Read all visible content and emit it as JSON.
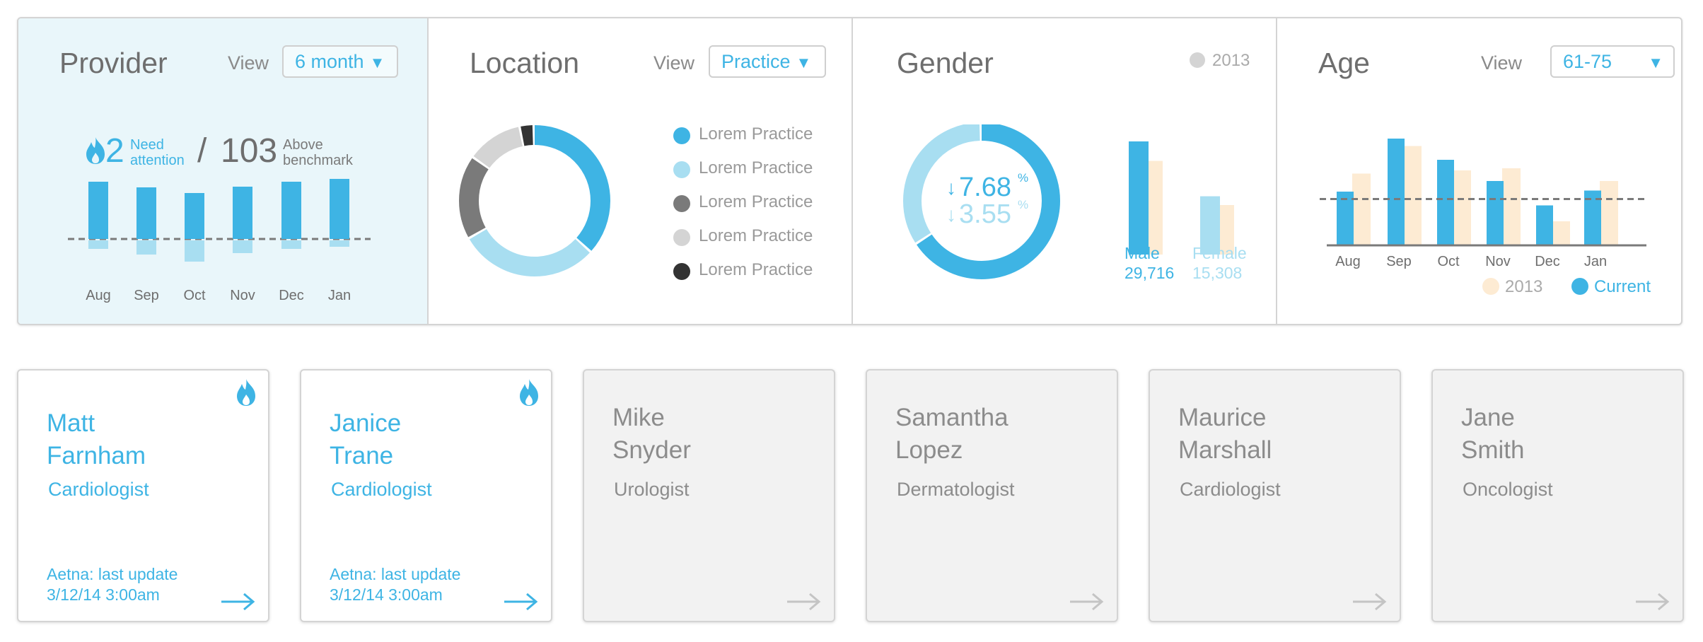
{
  "colors": {
    "accent": "#3eb4e4",
    "light_accent": "#a8def1",
    "beige": "#fdebd3",
    "panel_bg": "#e9f6fa",
    "inactive_card": "#f2f2f2"
  },
  "provider": {
    "title": "Provider",
    "view_label": "View",
    "view_value": "6 month",
    "need_attention_count": "2",
    "need_attention_label": "Need attention",
    "separator": "/",
    "above_count": "103",
    "above_label": "Above benchmark",
    "chart_data": {
      "type": "bar",
      "categories": [
        "Aug",
        "Sep",
        "Oct",
        "Nov",
        "Dec",
        "Jan"
      ],
      "series": [
        {
          "values": [
            81,
            73,
            65,
            74,
            81,
            85
          ]
        },
        {
          "values": [
            -12,
            -20,
            -30,
            -18,
            -12,
            -9
          ]
        }
      ],
      "benchmark": 0
    }
  },
  "location": {
    "title": "Location",
    "view_label": "View",
    "view_value": "Practice",
    "chart_data": {
      "type": "pie",
      "labels": [
        "Lorem Practice",
        "Lorem Practice",
        "Lorem Practice",
        "Lorem Practice",
        "Lorem Practice"
      ],
      "values": [
        37,
        30,
        18,
        12,
        3
      ],
      "colors": [
        "#3eb4e4",
        "#a8def1",
        "#7a7a7a",
        "#d4d4d4",
        "#333333"
      ]
    }
  },
  "gender": {
    "title": "Gender",
    "legend_2013": "2013",
    "pct_current": "7.68",
    "pct_2013": "3.55",
    "pct_sign": "%",
    "male_label": "Male",
    "male_value": "29,716",
    "female_label": "Female",
    "female_value": "15,308",
    "chart_data": [
      {
        "type": "pie",
        "labels": [
          "Male",
          "Female"
        ],
        "values": [
          66,
          34
        ]
      },
      {
        "type": "bar",
        "categories": [
          "Male",
          "Female"
        ],
        "series": [
          {
            "name": "Current",
            "values": [
              29716,
              15308
            ]
          },
          {
            "name": "2013",
            "values": [
              24600,
              13000
            ]
          }
        ]
      }
    ]
  },
  "age": {
    "title": "Age",
    "view_label": "View",
    "view_value": "61-75",
    "legend_2013": "2013",
    "legend_current": "Current",
    "chart_data": {
      "type": "bar",
      "categories": [
        "Aug",
        "Sep",
        "Oct",
        "Nov",
        "Dec",
        "Jan"
      ],
      "series": [
        {
          "name": "Current",
          "values": [
            50,
            100,
            80,
            60,
            37,
            51
          ]
        },
        {
          "name": "2013",
          "values": [
            67,
            93,
            70,
            72,
            22,
            60
          ]
        }
      ],
      "benchmark": 43
    }
  },
  "cards": [
    {
      "name": "Matt\nFarnham",
      "specialty": "Cardiologist",
      "update": "Aetna: last update\n3/12/14 3:00am",
      "active": true,
      "flag": "fire-icon"
    },
    {
      "name": "Janice\nTrane",
      "specialty": "Cardiologist",
      "update": "Aetna: last update\n3/12/14 3:00am",
      "active": true,
      "flag": "fire-icon"
    },
    {
      "name": "Mike\nSnyder",
      "specialty": "Urologist",
      "update": "",
      "active": false
    },
    {
      "name": "Samantha\nLopez",
      "specialty": "Dermatologist",
      "update": "",
      "active": false
    },
    {
      "name": "Maurice\nMarshall",
      "specialty": "Cardiologist",
      "update": "",
      "active": false
    },
    {
      "name": "Jane\nSmith",
      "specialty": "Oncologist",
      "update": "",
      "active": false
    }
  ]
}
